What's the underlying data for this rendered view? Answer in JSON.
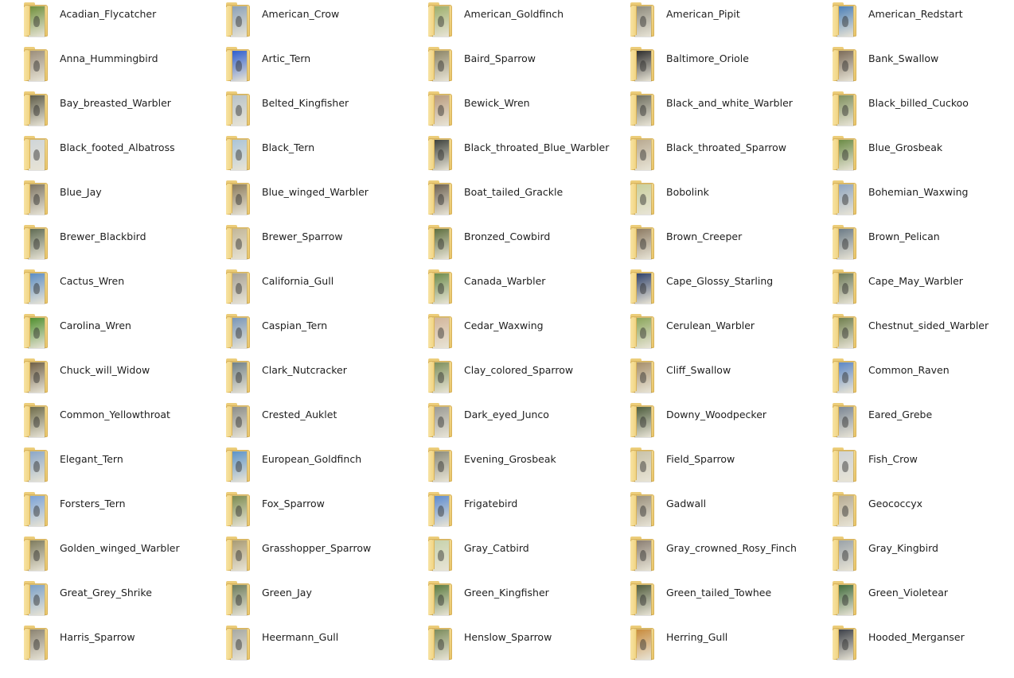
{
  "folders": [
    {
      "name": "Acadian_Flycatcher",
      "thumb": "#6f8f3a"
    },
    {
      "name": "American_Crow",
      "thumb": "#8aa0b8"
    },
    {
      "name": "American_Goldfinch",
      "thumb": "#9cae6a"
    },
    {
      "name": "American_Pipit",
      "thumb": "#8d8a7c"
    },
    {
      "name": "American_Redstart",
      "thumb": "#4a7fb8"
    },
    {
      "name": "Anna_Hummingbird",
      "thumb": "#9a8d7a"
    },
    {
      "name": "Artic_Tern",
      "thumb": "#2a5ccf"
    },
    {
      "name": "Baird_Sparrow",
      "thumb": "#8b8465"
    },
    {
      "name": "Baltimore_Oriole",
      "thumb": "#2b2b2b"
    },
    {
      "name": "Bank_Swallow",
      "thumb": "#7a6a58"
    },
    {
      "name": "Bay_breasted_Warbler",
      "thumb": "#5c5a46"
    },
    {
      "name": "Belted_Kingfisher",
      "thumb": "#b7c2c8"
    },
    {
      "name": "Bewick_Wren",
      "thumb": "#b89a7c"
    },
    {
      "name": "Black_and_white_Warbler",
      "thumb": "#6d6d5e"
    },
    {
      "name": "Black_billed_Cuckoo",
      "thumb": "#7e8f5c"
    },
    {
      "name": "Black_footed_Albatross",
      "thumb": "#cfd5d8"
    },
    {
      "name": "Black_Tern",
      "thumb": "#aac4d8"
    },
    {
      "name": "Black_throated_Blue_Warbler",
      "thumb": "#3b3f3a"
    },
    {
      "name": "Black_throated_Sparrow",
      "thumb": "#b8a990"
    },
    {
      "name": "Blue_Grosbeak",
      "thumb": "#6a8a44"
    },
    {
      "name": "Blue_Jay",
      "thumb": "#7d7462"
    },
    {
      "name": "Blue_winged_Warbler",
      "thumb": "#8a7a5a"
    },
    {
      "name": "Boat_tailed_Grackle",
      "thumb": "#6a5e4e"
    },
    {
      "name": "Bobolink",
      "thumb": "#c9d09c"
    },
    {
      "name": "Bohemian_Waxwing",
      "thumb": "#8da4c0"
    },
    {
      "name": "Brewer_Blackbird",
      "thumb": "#5e6a52"
    },
    {
      "name": "Brewer_Sparrow",
      "thumb": "#c2b697"
    },
    {
      "name": "Bronzed_Cowbird",
      "thumb": "#5c6d3c"
    },
    {
      "name": "Brown_Creeper",
      "thumb": "#8c7a62"
    },
    {
      "name": "Brown_Pelican",
      "thumb": "#6a7a86"
    },
    {
      "name": "Cactus_Wren",
      "thumb": "#5a8cc4"
    },
    {
      "name": "California_Gull",
      "thumb": "#a7a195"
    },
    {
      "name": "Canada_Warbler",
      "thumb": "#6b8a4a"
    },
    {
      "name": "Cape_Glossy_Starling",
      "thumb": "#2c3f6a"
    },
    {
      "name": "Cape_May_Warbler",
      "thumb": "#6c7a58"
    },
    {
      "name": "Carolina_Wren",
      "thumb": "#4f8f2e"
    },
    {
      "name": "Caspian_Tern",
      "thumb": "#7795b8"
    },
    {
      "name": "Cedar_Waxwing",
      "thumb": "#d2b59a"
    },
    {
      "name": "Cerulean_Warbler",
      "thumb": "#8aa55a"
    },
    {
      "name": "Chestnut_sided_Warbler",
      "thumb": "#6f7e4c"
    },
    {
      "name": "Chuck_will_Widow",
      "thumb": "#6e5e44"
    },
    {
      "name": "Clark_Nutcracker",
      "thumb": "#6f7f86"
    },
    {
      "name": "Clay_colored_Sparrow",
      "thumb": "#7c8e5a"
    },
    {
      "name": "Cliff_Swallow",
      "thumb": "#a68e6a"
    },
    {
      "name": "Common_Raven",
      "thumb": "#5b86c6"
    },
    {
      "name": "Common_Yellowthroat",
      "thumb": "#6d6a48"
    },
    {
      "name": "Crested_Auklet",
      "thumb": "#8a8c88"
    },
    {
      "name": "Dark_eyed_Junco",
      "thumb": "#9a9a94"
    },
    {
      "name": "Downy_Woodpecker",
      "thumb": "#4a5a3a"
    },
    {
      "name": "Eared_Grebe",
      "thumb": "#7a8694"
    },
    {
      "name": "Elegant_Tern",
      "thumb": "#8aa6c8"
    },
    {
      "name": "European_Goldfinch",
      "thumb": "#5a92c8"
    },
    {
      "name": "Evening_Grosbeak",
      "thumb": "#8a8a7a"
    },
    {
      "name": "Field_Sparrow",
      "thumb": "#c8c2a8"
    },
    {
      "name": "Fish_Crow",
      "thumb": "#cfd3d6"
    },
    {
      "name": "Forsters_Tern",
      "thumb": "#7aa2d8"
    },
    {
      "name": "Fox_Sparrow",
      "thumb": "#7a8a4e"
    },
    {
      "name": "Frigatebird",
      "thumb": "#5a8ad0"
    },
    {
      "name": "Gadwall",
      "thumb": "#9a907c"
    },
    {
      "name": "Geococcyx",
      "thumb": "#b6ab92"
    },
    {
      "name": "Golden_winged_Warbler",
      "thumb": "#7d7a5c"
    },
    {
      "name": "Grasshopper_Sparrow",
      "thumb": "#a89a72"
    },
    {
      "name": "Gray_Catbird",
      "thumb": "#c7d2ac"
    },
    {
      "name": "Gray_crowned_Rosy_Finch",
      "thumb": "#8a7e72"
    },
    {
      "name": "Gray_Kingbird",
      "thumb": "#9aa2a8"
    },
    {
      "name": "Great_Grey_Shrike",
      "thumb": "#7aa0c8"
    },
    {
      "name": "Green_Jay",
      "thumb": "#6a7a5a"
    },
    {
      "name": "Green_Kingfisher",
      "thumb": "#5a7a3e"
    },
    {
      "name": "Green_tailed_Towhee",
      "thumb": "#4e5a3a"
    },
    {
      "name": "Green_Violetear",
      "thumb": "#3e6a3a"
    },
    {
      "name": "Harris_Sparrow",
      "thumb": "#8a8270"
    },
    {
      "name": "Heermann_Gull",
      "thumb": "#a6a8a2"
    },
    {
      "name": "Henslow_Sparrow",
      "thumb": "#7a8a5a"
    },
    {
      "name": "Herring_Gull",
      "thumb": "#c88a3a"
    },
    {
      "name": "Hooded_Merganser",
      "thumb": "#3a3e46"
    }
  ]
}
